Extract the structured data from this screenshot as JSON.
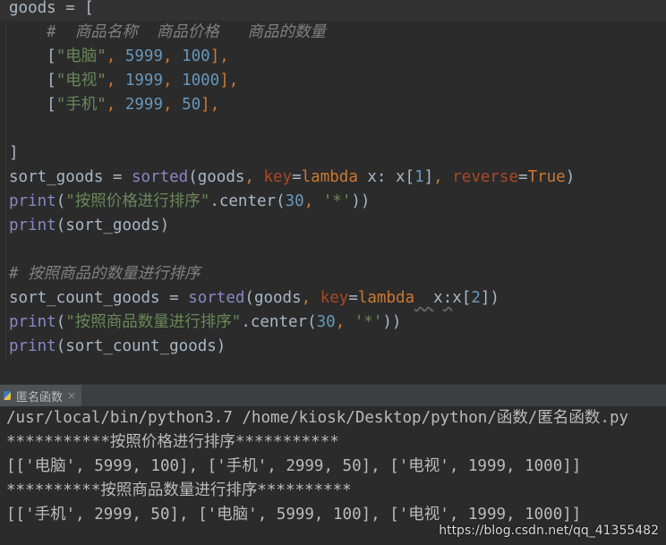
{
  "editor": {
    "lines": [
      {
        "tokens": [
          {
            "t": "goods = [",
            "c": ""
          }
        ]
      },
      {
        "tokens": [
          {
            "t": "    ",
            "c": ""
          },
          {
            "t": "#  商品名称  商品价格   商品的数量",
            "c": "cmt"
          }
        ]
      },
      {
        "tokens": [
          {
            "t": "    [",
            "c": ""
          },
          {
            "t": "\"电脑\"",
            "c": "str"
          },
          {
            "t": ", ",
            "c": "kw"
          },
          {
            "t": "5999",
            "c": "num"
          },
          {
            "t": ", ",
            "c": "kw"
          },
          {
            "t": "100",
            "c": "num"
          },
          {
            "t": "],",
            "c": "kw"
          }
        ]
      },
      {
        "tokens": [
          {
            "t": "    [",
            "c": ""
          },
          {
            "t": "\"电视\"",
            "c": "str"
          },
          {
            "t": ", ",
            "c": "kw"
          },
          {
            "t": "1999",
            "c": "num"
          },
          {
            "t": ", ",
            "c": "kw"
          },
          {
            "t": "1000",
            "c": "num"
          },
          {
            "t": "],",
            "c": "kw"
          }
        ]
      },
      {
        "tokens": [
          {
            "t": "    [",
            "c": ""
          },
          {
            "t": "\"手机\"",
            "c": "str"
          },
          {
            "t": ", ",
            "c": "kw"
          },
          {
            "t": "2999",
            "c": "num"
          },
          {
            "t": ", ",
            "c": "kw"
          },
          {
            "t": "50",
            "c": "num"
          },
          {
            "t": "],",
            "c": "kw"
          }
        ]
      },
      {
        "tokens": [
          {
            "t": "",
            "c": ""
          }
        ]
      },
      {
        "tokens": [
          {
            "t": "]",
            "c": ""
          }
        ]
      },
      {
        "tokens": [
          {
            "t": "sort_goods = ",
            "c": ""
          },
          {
            "t": "sorted",
            "c": "bi"
          },
          {
            "t": "(goods",
            "c": ""
          },
          {
            "t": ", ",
            "c": "kw"
          },
          {
            "t": "key",
            "c": "kwarg"
          },
          {
            "t": "=",
            "c": ""
          },
          {
            "t": "lambda",
            "c": "lam"
          },
          {
            "t": " x: x[",
            "c": ""
          },
          {
            "t": "1",
            "c": "num"
          },
          {
            "t": "]",
            "c": ""
          },
          {
            "t": ", ",
            "c": "kw"
          },
          {
            "t": "reverse",
            "c": "kwarg"
          },
          {
            "t": "=",
            "c": ""
          },
          {
            "t": "True",
            "c": "kw"
          },
          {
            "t": ")",
            "c": ""
          }
        ]
      },
      {
        "tokens": [
          {
            "t": "print",
            "c": "bi"
          },
          {
            "t": "(",
            "c": ""
          },
          {
            "t": "\"按照价格进行排序\"",
            "c": "str"
          },
          {
            "t": ".center(",
            "c": ""
          },
          {
            "t": "30",
            "c": "num"
          },
          {
            "t": ", ",
            "c": "kw"
          },
          {
            "t": "'*'",
            "c": "str"
          },
          {
            "t": "))",
            "c": ""
          }
        ]
      },
      {
        "tokens": [
          {
            "t": "print",
            "c": "bi"
          },
          {
            "t": "(sort_goods)",
            "c": ""
          }
        ]
      },
      {
        "tokens": [
          {
            "t": "",
            "c": ""
          }
        ]
      },
      {
        "tokens": [
          {
            "t": "# 按照商品的数量进行排序",
            "c": "cmt"
          }
        ]
      },
      {
        "tokens": [
          {
            "t": "sort_count_goods = ",
            "c": ""
          },
          {
            "t": "sorted",
            "c": "bi"
          },
          {
            "t": "(goods",
            "c": ""
          },
          {
            "t": ", ",
            "c": "kw"
          },
          {
            "t": "key",
            "c": "kwarg"
          },
          {
            "t": "=",
            "c": ""
          },
          {
            "t": "lambda",
            "c": "lam"
          },
          {
            "t": "  ",
            "c": "wavy"
          },
          {
            "t": "x",
            "c": ""
          },
          {
            "t": ":",
            "c": "wavy"
          },
          {
            "t": "x[",
            "c": ""
          },
          {
            "t": "2",
            "c": "num"
          },
          {
            "t": "])",
            "c": ""
          }
        ]
      },
      {
        "tokens": [
          {
            "t": "print",
            "c": "bi"
          },
          {
            "t": "(",
            "c": ""
          },
          {
            "t": "\"按照商品数量进行排序\"",
            "c": "str"
          },
          {
            "t": ".center(",
            "c": ""
          },
          {
            "t": "30",
            "c": "num"
          },
          {
            "t": ", ",
            "c": "kw"
          },
          {
            "t": "'*'",
            "c": "str"
          },
          {
            "t": "))",
            "c": ""
          }
        ]
      },
      {
        "tokens": [
          {
            "t": "print",
            "c": "bi"
          },
          {
            "t": "(sort_count_goods)",
            "c": ""
          }
        ]
      }
    ]
  },
  "run_panel": {
    "tab_label": "匿名函数",
    "close_glyph": "×"
  },
  "console": {
    "lines": [
      "/usr/local/bin/python3.7 /home/kiosk/Desktop/python/函数/匿名函数.py",
      "***********按照价格进行排序***********",
      "[['电脑', 5999, 100], ['手机', 2999, 50], ['电视', 1999, 1000]]",
      "**********按照商品数量进行排序**********",
      "[['手机', 2999, 50], ['电脑', 5999, 100], ['电视', 1999, 1000]]"
    ]
  },
  "watermark": "https://blog.csdn.net/qq_41355482",
  "colors": {
    "background": "#2b2b2b",
    "comment": "#808080",
    "string": "#6a8759",
    "number": "#6897bb",
    "keyword": "#cc7832",
    "builtin": "#8888c6",
    "kwarg": "#aa4926",
    "text": "#a9b7c6"
  }
}
